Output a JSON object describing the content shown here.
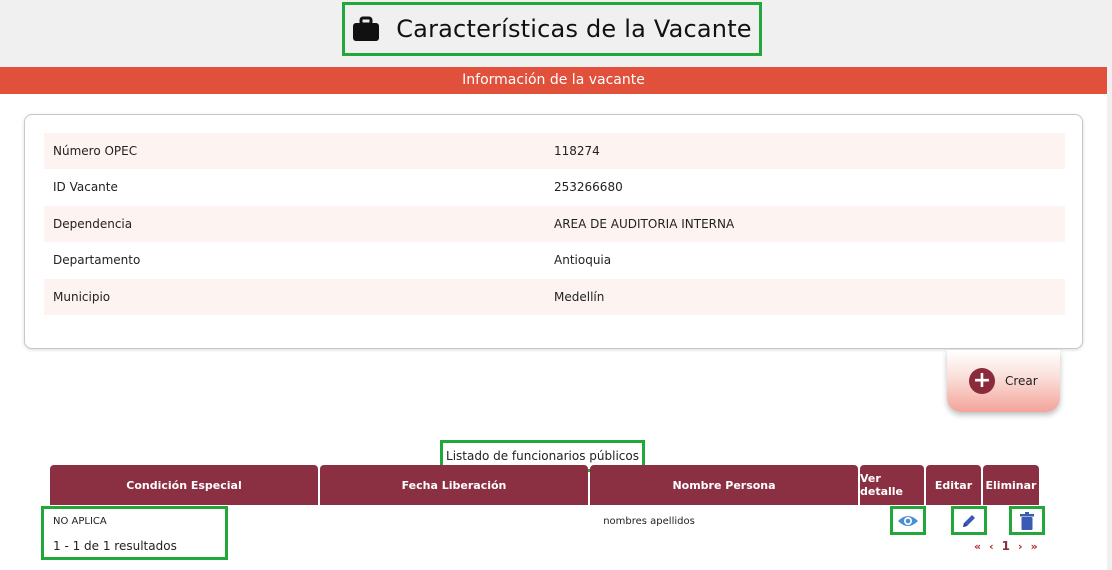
{
  "page_title": "Características de la Vacante",
  "panel_header": "Información de la vacante",
  "info_rows": [
    {
      "label": "Número OPEC",
      "value": "118274"
    },
    {
      "label": "ID Vacante",
      "value": "253266680"
    },
    {
      "label": "Dependencia",
      "value": "AREA DE AUDITORIA INTERNA"
    },
    {
      "label": "Departamento",
      "value": "Antioquia"
    },
    {
      "label": "Municipio",
      "value": "Medellín"
    }
  ],
  "create_button": {
    "icon": "plus-circle-icon",
    "label": "Crear"
  },
  "list_title": "Listado de funcionarios públicos",
  "table": {
    "headers": [
      "Condición Especial",
      "Fecha Liberación",
      "Nombre Persona",
      "Ver detalle",
      "Editar",
      "Eliminar"
    ],
    "rows": [
      {
        "condicion": "NO APLICA",
        "fecha": "",
        "nombre": "nombres apellidos"
      }
    ]
  },
  "results_text": "1 - 1 de 1 resultados",
  "pagination": {
    "first": "«",
    "prev": "‹",
    "page": "1",
    "next": "›",
    "last": "»"
  },
  "colors": {
    "header_accent": "#e0503a",
    "table_header": "#8b2f42",
    "highlight": "#22a83a"
  },
  "icons": {
    "title": "briefcase-icon",
    "view": "eye-icon",
    "edit": "pencil-icon",
    "delete": "trash-icon"
  }
}
